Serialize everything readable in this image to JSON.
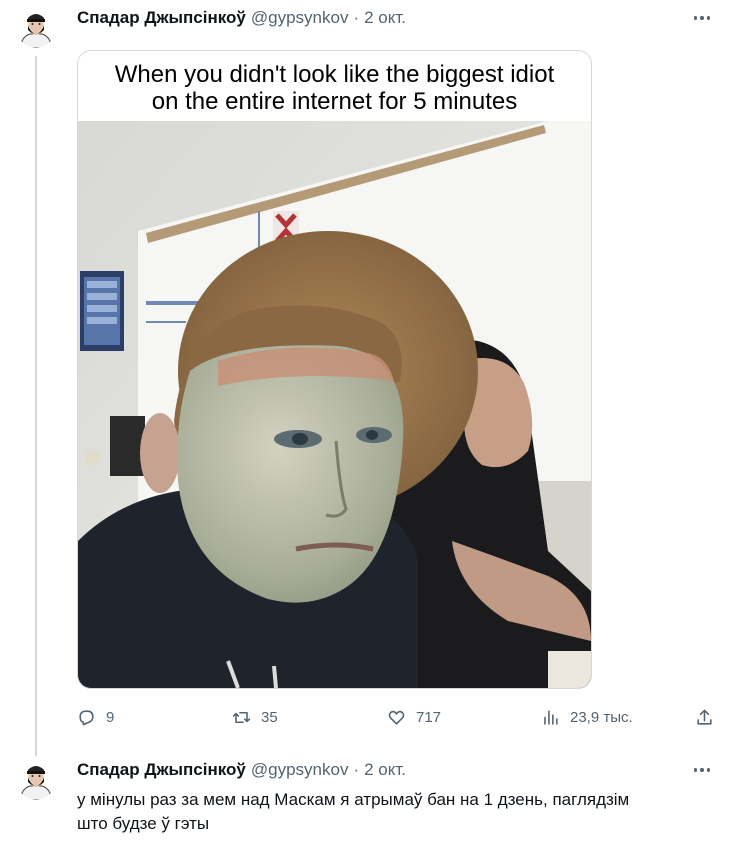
{
  "tweets": [
    {
      "author": {
        "name": "Спадар Джыпсінкоў",
        "handle": "@gypsynkov",
        "separator": "·",
        "time": "2 окт."
      },
      "media": {
        "caption_line1": "When you didn't look like the biggest idiot",
        "caption_line2": "on the entire internet for 5 minutes"
      },
      "actions": {
        "replies": "9",
        "retweets": "35",
        "likes": "717",
        "views": "23,9 тыс."
      }
    },
    {
      "author": {
        "name": "Спадар Джыпсінкоў",
        "handle": "@gypsynkov",
        "separator": "·",
        "time": "2 окт."
      },
      "text_line1": "у мінулы раз за мем над Маскам я атрымаў бан на 1 дзень, паглядзім",
      "text_line2": "што будзе ў гэты"
    }
  ],
  "colors": {
    "text": "#0f1419",
    "secondary": "#536471",
    "border": "#cfd9de"
  },
  "icons": [
    "reply-icon",
    "retweet-icon",
    "like-icon",
    "views-icon",
    "share-icon",
    "more-icon"
  ]
}
